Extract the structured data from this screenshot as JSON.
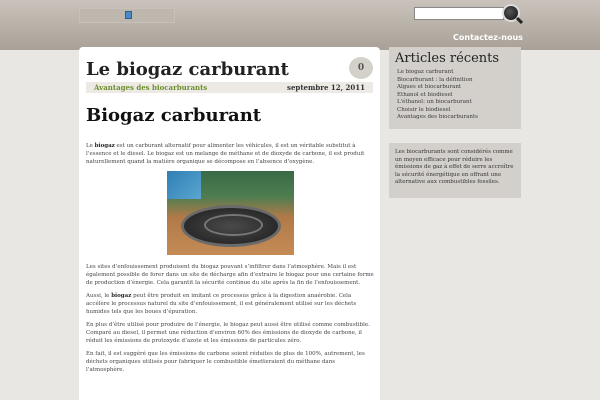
{
  "header": {
    "search_placeholder": "",
    "nav_link": "Contactez-nous"
  },
  "post": {
    "title": "Le biogaz carburant",
    "comment_count": "0",
    "category": "Avantages des biocarburants",
    "date": "septembre 12, 2011",
    "heading": "Biogaz carburant",
    "p1_a": "Le ",
    "p1_bold": "biogaz",
    "p1_b": " est un carburant alternatif pour alimenter les véhicules, il est un véritable substitut à l’essence et le diesel. Le biogaz est un melange de méthane et de dioxyde de carbone, il est produit naturellement quand la matière organique se décompose en l’absence d’oxygène.",
    "p2": "Les sites d’enfouissement produisent du biogaz pouvant s’infiltrer dans l’atmosphère.  Mais il est également possible de forer dans un site de décharge afin d’extraire le biogaz pour une certaine forme de production d’énergie. Cela garantit la sécurité continue du site après la fin de l’enfouissement.",
    "p3_a": "Aussi, le ",
    "p3_bold": "biogaz",
    "p3_b": " peut être produit en imitant ce processus grâce à la digestion anaérobie. Cela accélère le processus naturel du site d’enfouissement, il est généralement utilisé sur les déchets humides tels que les boues d’épuration.",
    "p4": "En plus d’être utilisé pour produire de l’énergie, le biogaz peut aussi être utilisé comme combustible. Comparé au diesel, il permet une réduction d’environ 60% des émissions de dioxyde de carbone, il réduit les émissions de protoxyde d’azote et les émissions de particules zéro.",
    "p5": "En fait, il est suggéré que les émissions de carbone soient réduites de plus de 100%, autrement, les déchets organiques utilisés pour fabriquer le combustible émetteraient du méthane dans l’atmosphère."
  },
  "sidebar": {
    "recent_title": "Articles récents",
    "recent_items": [
      "Le biogaz carburant",
      "Biocarburant : la définition",
      "Algues et biocarburant",
      "Ethanol et biodiesel",
      "L'éthanol: un biocarburant",
      "Choisir le biodiesel",
      "Avantages des biocarburants"
    ],
    "text_widget": "Les biocarburants sont considérés comme un moyen efficace pour réduire les émissions de gaz à effet de serre accroître la sécurité énergétique en offrant une alternative aux combustibles fossiles."
  }
}
